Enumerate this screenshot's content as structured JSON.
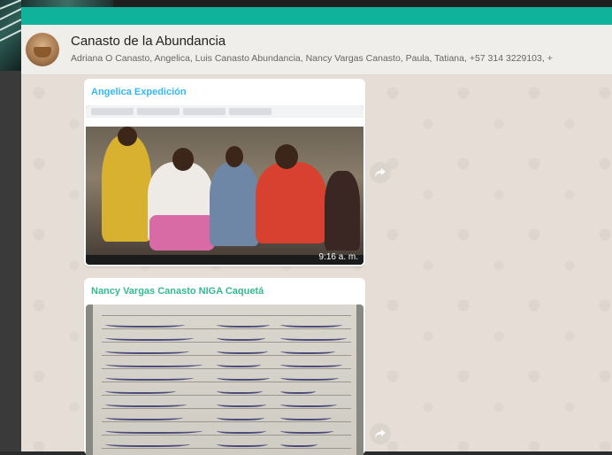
{
  "chat": {
    "title": "Canasto de la Abundancia",
    "members": "Adriana O Canasto, Angelica, Luis Canasto Abundancia, Nancy Vargas Canasto, Paula, Tatiana, +57 314 3229103, +"
  },
  "messages": [
    {
      "sender": "Angelica Expedición",
      "type": "image",
      "timestamp": "9:16 a. m."
    },
    {
      "sender": "Nancy Vargas Canasto NIGA Caquetá",
      "type": "image"
    }
  ],
  "colors": {
    "header_teal": "#10b29b",
    "sender1": "#34b7f1",
    "sender2": "#35b992"
  },
  "icons": [
    "forward-icon",
    "group-avatar"
  ]
}
